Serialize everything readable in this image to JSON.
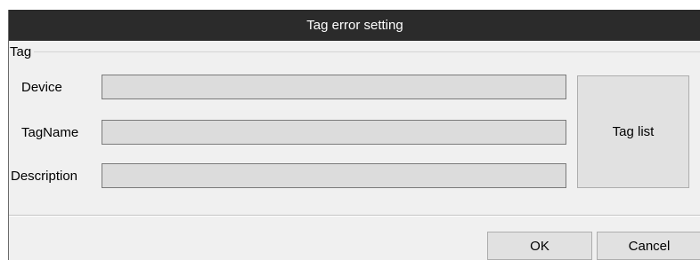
{
  "window": {
    "title": "Tag error setting"
  },
  "group": {
    "title": "Tag"
  },
  "fields": [
    {
      "label": "Device",
      "value": ""
    },
    {
      "label": "TagName",
      "value": ""
    },
    {
      "label": "Description",
      "value": ""
    }
  ],
  "buttons": {
    "tag_list": "Tag list",
    "ok": "OK",
    "cancel": "Cancel"
  },
  "colors": {
    "titlebar": "#2b2b2b",
    "window_bg": "#f0f0f0",
    "input_bg": "#dcdcdc",
    "button_bg": "#e1e1e1"
  }
}
